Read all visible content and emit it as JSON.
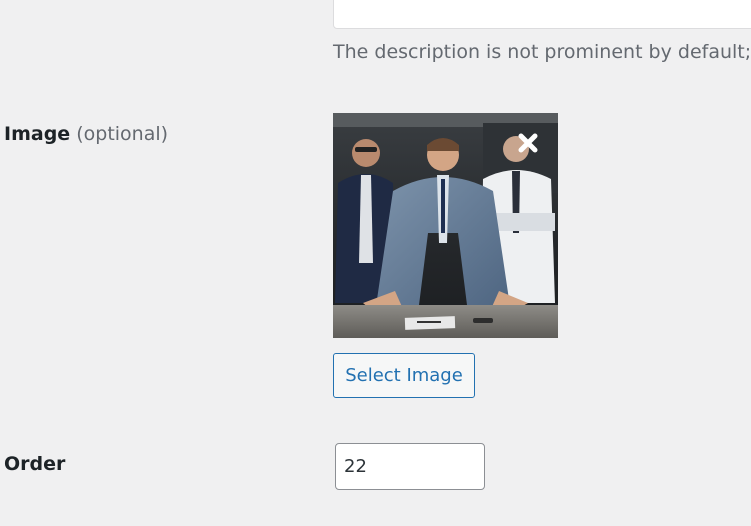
{
  "description": {
    "help_text": "The description is not prominent by default; however, some themes may show it."
  },
  "image_field": {
    "label": "Image",
    "optional_note": "(optional)",
    "select_button_label": "Select Image",
    "preview_alt": "Business team photo",
    "remove_icon": "close-icon"
  },
  "order_field": {
    "label": "Order",
    "value": "22"
  },
  "colors": {
    "background": "#f0f0f1",
    "accent": "#2271b1",
    "muted_text": "#646970"
  }
}
